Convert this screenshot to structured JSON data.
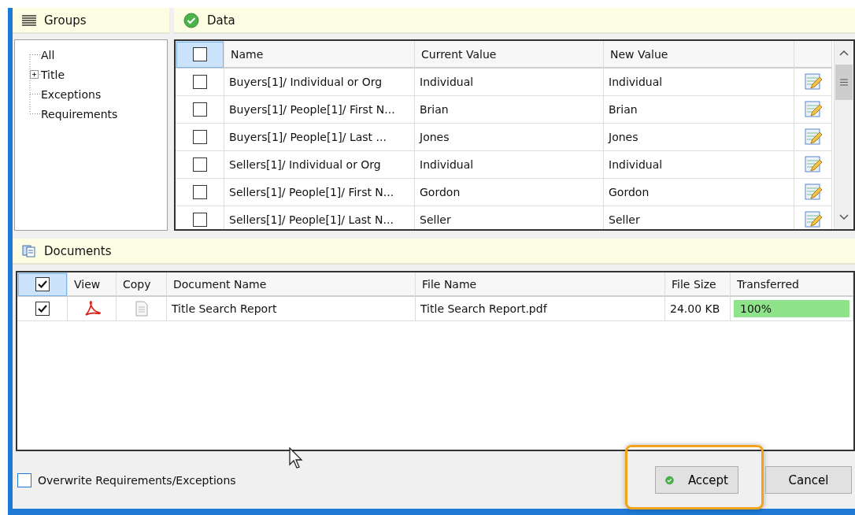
{
  "groups": {
    "title": "Groups",
    "tree": [
      {
        "label": "All"
      },
      {
        "label": "Title",
        "expanded": false
      },
      {
        "label": "Exceptions"
      },
      {
        "label": "Requirements"
      }
    ]
  },
  "data": {
    "title": "Data",
    "all_checked": false,
    "columns": [
      "Name",
      "Current Value",
      "New Value"
    ],
    "rows": [
      {
        "checked": false,
        "name": "Buyers[1]/ Individual or Org",
        "current": "Individual",
        "new": "Individual"
      },
      {
        "checked": false,
        "name": "Buyers[1]/ People[1]/ First N...",
        "current": "Brian",
        "new": "Brian"
      },
      {
        "checked": false,
        "name": "Buyers[1]/ People[1]/ Last ...",
        "current": "Jones",
        "new": "Jones"
      },
      {
        "checked": false,
        "name": "Sellers[1]/ Individual or Org",
        "current": "Individual",
        "new": "Individual"
      },
      {
        "checked": false,
        "name": "Sellers[1]/ People[1]/ First N...",
        "current": "Gordon",
        "new": "Gordon"
      },
      {
        "checked": false,
        "name": "Sellers[1]/ People[1]/ Last N...",
        "current": "Seller",
        "new": "Seller"
      }
    ]
  },
  "documents": {
    "title": "Documents",
    "all_checked": true,
    "columns": [
      "View",
      "Copy",
      "Document Name",
      "File Name",
      "File Size",
      "Transferred"
    ],
    "rows": [
      {
        "checked": true,
        "document_name": "Title Search Report",
        "file_name": "Title Search Report.pdf",
        "file_size": "24.00 KB",
        "transferred": "100%",
        "level": 1
      }
    ]
  },
  "overwrite": {
    "label": "Overwrite Requirements/Exceptions",
    "checked": false
  },
  "buttons": [
    {
      "label": "Accept",
      "kind": "accept",
      "highlighted": true
    },
    {
      "label": "Cancel",
      "kind": "cancel",
      "highlighted": false
    }
  ]
}
